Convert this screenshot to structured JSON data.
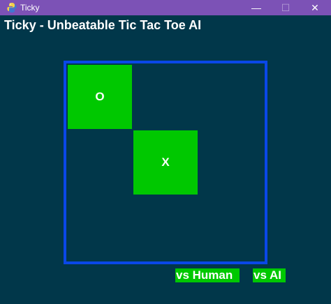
{
  "window": {
    "title": "Ticky",
    "controls": {
      "minimize": "—",
      "maximize": "☐",
      "close": "✕"
    },
    "icon": "python-icon"
  },
  "header": {
    "title": "Ticky - Unbeatable Tic Tac Toe AI"
  },
  "board": {
    "cells": [
      "O",
      "",
      "",
      "",
      "X",
      "",
      "",
      "",
      ""
    ]
  },
  "buttons": {
    "vs_human": "vs Human",
    "vs_ai": "vs AI"
  },
  "colors": {
    "background": "#01374a",
    "titlebar": "#7c52b6",
    "board_border": "#0a47e8",
    "cell_fill": "#00c800",
    "text": "#ffffff"
  }
}
